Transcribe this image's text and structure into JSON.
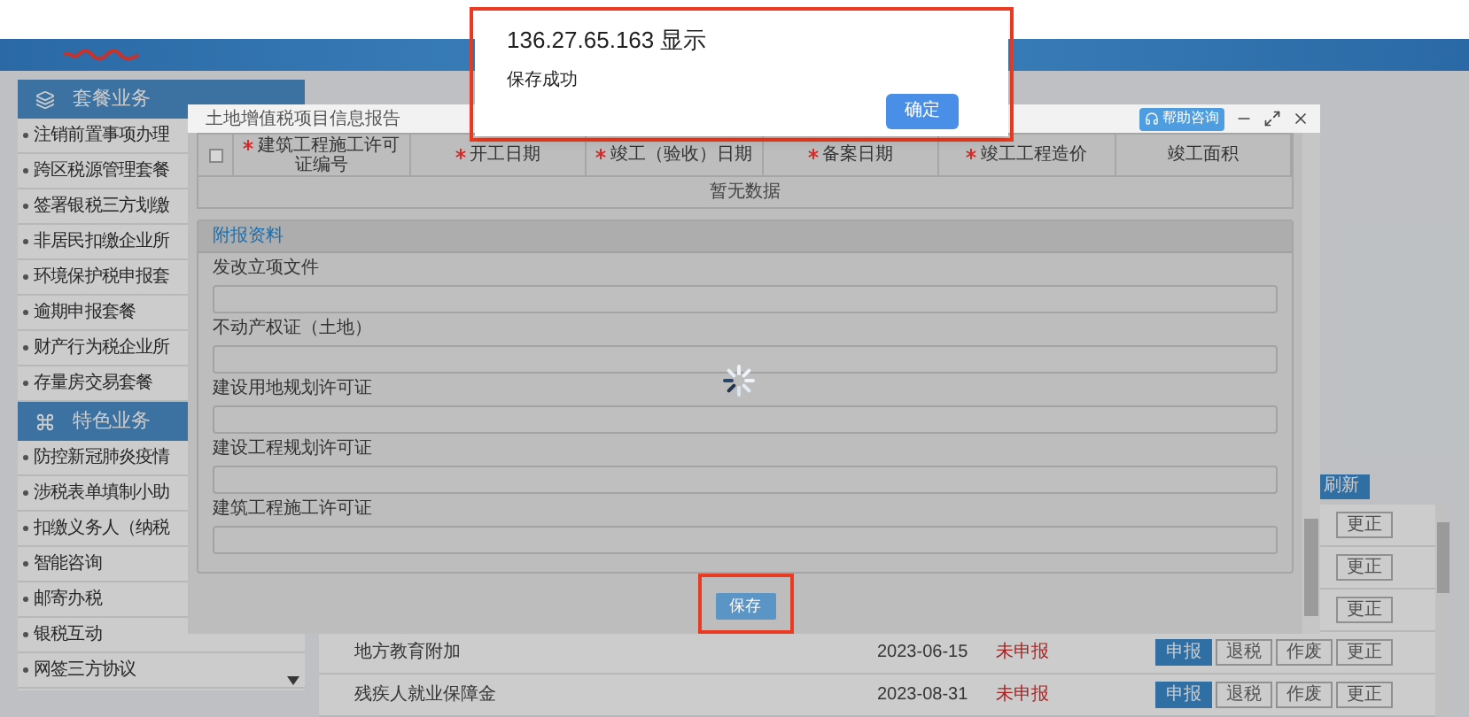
{
  "alert": {
    "title": "136.27.65.163 显示",
    "message": "保存成功",
    "ok_button": "确定"
  },
  "sidebar": {
    "groups": [
      {
        "title": "套餐业务",
        "kind": "package",
        "items": [
          "注销前置事项办理",
          "跨区税源管理套餐",
          "签署银税三方划缴",
          "非居民扣缴企业所",
          "环境保护税申报套",
          "逾期申报套餐",
          "财产行为税企业所",
          "存量房交易套餐"
        ]
      },
      {
        "title": "特色业务",
        "kind": "feature",
        "items": [
          "防控新冠肺炎疫情",
          "涉税表单填制小助",
          "扣缴义务人（纳税",
          "智能咨询",
          "邮寄办税",
          "银税互动",
          "网签三方协议"
        ]
      }
    ]
  },
  "main": {
    "refresh_button": "刷新",
    "rows": [
      {
        "buttons": [
          {
            "label": "更正",
            "kind": "default"
          }
        ]
      },
      {
        "buttons": [
          {
            "label": "更正",
            "kind": "default"
          }
        ]
      },
      {
        "buttons": [
          {
            "label": "更正",
            "kind": "default"
          }
        ]
      },
      {
        "name": "地方教育附加",
        "date": "2023-06-15",
        "status": "未申报",
        "buttons": [
          {
            "label": "申报",
            "kind": "primary"
          },
          {
            "label": "退税",
            "kind": "default"
          },
          {
            "label": "作废",
            "kind": "default"
          },
          {
            "label": "更正",
            "kind": "default"
          }
        ]
      },
      {
        "name": "残疾人就业保障金",
        "date": "2023-08-31",
        "status": "未申报",
        "buttons": [
          {
            "label": "申报",
            "kind": "primary"
          },
          {
            "label": "退税",
            "kind": "default"
          },
          {
            "label": "作废",
            "kind": "default"
          },
          {
            "label": "更正",
            "kind": "default"
          }
        ]
      }
    ]
  },
  "dialog": {
    "title": "土地增值税项目信息报告",
    "help_button": "帮助咨询",
    "table": {
      "select_all": {
        "checked": false
      },
      "columns": [
        {
          "label": "建筑工程施工许可证编号",
          "required": true
        },
        {
          "label": "开工日期",
          "required": true
        },
        {
          "label": "竣工（验收）日期",
          "required": true
        },
        {
          "label": "备案日期",
          "required": true
        },
        {
          "label": "竣工工程造价",
          "required": true
        },
        {
          "label": "竣工面积",
          "required": false
        }
      ],
      "empty_text": "暂无数据"
    },
    "attachments": {
      "title": "附报资料",
      "fields": [
        {
          "label": "发改立项文件"
        },
        {
          "label": "不动产权证（土地）"
        },
        {
          "label": "建设用地规划许可证"
        },
        {
          "label": "建设工程规划许可证"
        },
        {
          "label": "建筑工程施工许可证"
        }
      ]
    },
    "save_button": "保存"
  }
}
